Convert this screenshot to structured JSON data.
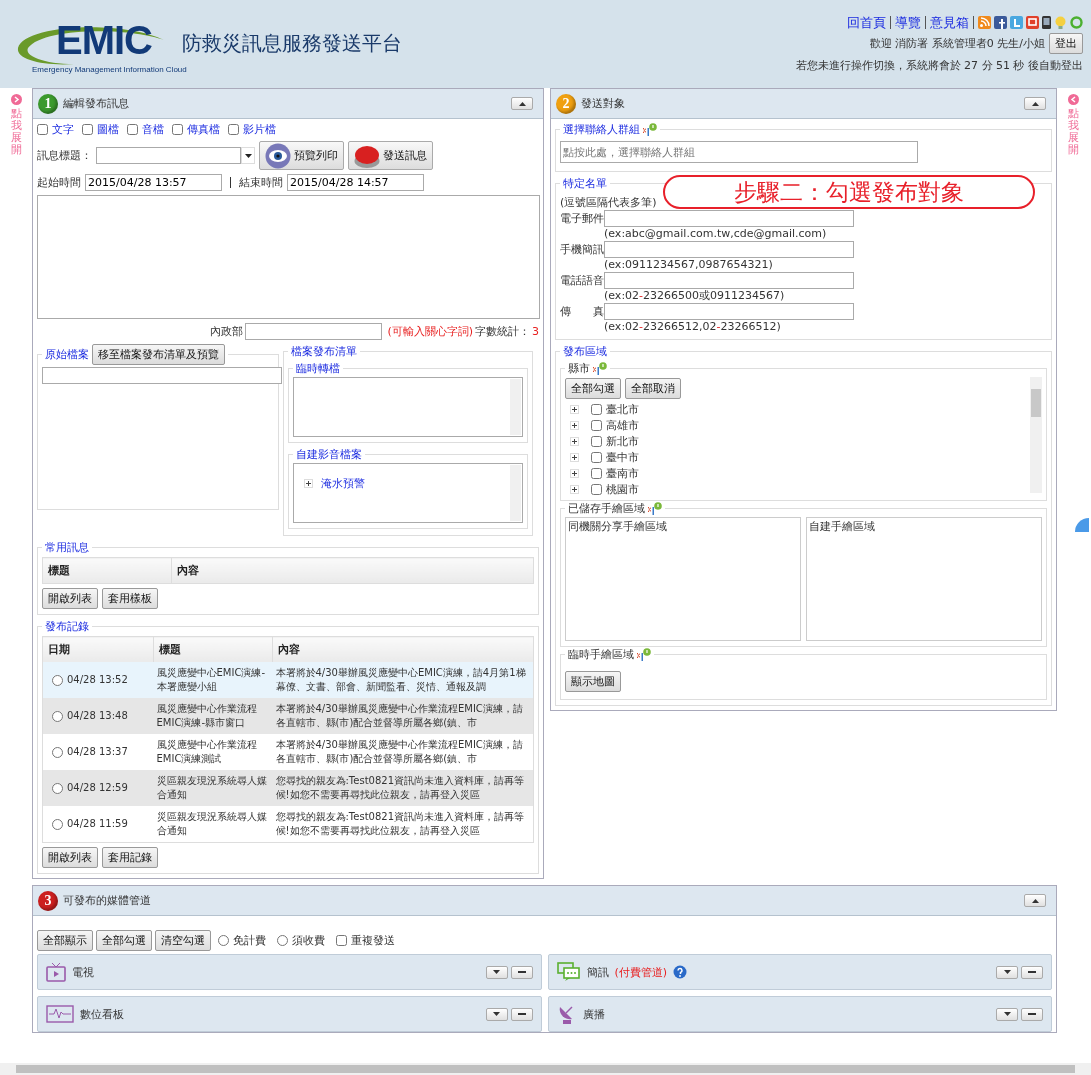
{
  "header": {
    "logo": "EMIC",
    "logo_subtitle": "Emergency Management Information Cloud",
    "title": "防救災訊息服務發送平台",
    "links": [
      "回首頁",
      "導覽",
      "意見箱"
    ],
    "welcome": "歡迎 消防署 系統管理者0 先生/小姐",
    "logout": "登出",
    "timeout": "若您未進行操作切換，系統將會於 27 分 51 秒 後自動登出"
  },
  "side_tabs": [
    "點我展開",
    "點我展開"
  ],
  "edit_panel": {
    "step": "1",
    "title": "編輯發布訊息",
    "file_types": [
      {
        "label": "文字",
        "checked": false
      },
      {
        "label": "圖檔",
        "checked": false
      },
      {
        "label": "音檔",
        "checked": false
      },
      {
        "label": "傳真檔",
        "checked": false
      },
      {
        "label": "影片檔",
        "checked": false
      }
    ],
    "subject_label": "訊息標題：",
    "preview_button": "預覽列印",
    "send_button": "發送訊息",
    "start_label": "起始時間",
    "start_value": "2015/04/28 13:57",
    "end_label": "結束時間",
    "end_value": "2015/04/28 14:57",
    "dept_label": "內政部",
    "keyword_hint": "(可輸入關心字詞)",
    "count_label": "字數統計：",
    "count": "3",
    "original_files": {
      "legend": "原始檔案",
      "move_button": "移至檔案發布清單及預覽"
    },
    "publish_list": {
      "legend": "檔案發布清單",
      "temp_legend": "臨時轉檔",
      "custom_legend": "自建影音檔案",
      "custom_items": [
        {
          "label": "淹水預警",
          "expanded": false
        }
      ]
    },
    "common": {
      "legend": "常用訊息",
      "columns": [
        "標題",
        "內容"
      ],
      "buttons": [
        "開啟列表",
        "套用樣板"
      ]
    },
    "history": {
      "legend": "發布記錄",
      "columns": [
        "日期",
        "標題",
        "內容"
      ],
      "rows": [
        {
          "date": "04/28 13:52",
          "title": "風災應變中心EMIC演練-本署應變小組",
          "content": "本署將於4/30舉辦風災應變中心EMIC演練，請4月第1梯幕僚、文書、部會、新聞監看、災情、通報及調",
          "selected": false,
          "highlighted": true
        },
        {
          "date": "04/28 13:48",
          "title": "風災應變中心作業流程EMIC演練-縣市窗口",
          "content": "本署將於4/30舉辦風災應變中心作業流程EMIC演練，請各直轄市、縣(市)配合並督導所屬各鄉(鎮、市",
          "selected": false,
          "highlighted": false
        },
        {
          "date": "04/28 13:37",
          "title": "風災應變中心作業流程EMIC演練測試",
          "content": "本署將於4/30舉辦風災應變中心作業流程EMIC演練，請各直轄市、縣(市)配合並督導所屬各鄉(鎮、市",
          "selected": false,
          "highlighted": false
        },
        {
          "date": "04/28 12:59",
          "title": "災區親友現況系統尋人媒合通知",
          "content": "您尋找的親友為:Test0821資訊尚未進入資料庫，請再等候!如您不需要再尋找此位親友，請再登入災區",
          "selected": false,
          "highlighted": false
        },
        {
          "date": "04/28 11:59",
          "title": "災區親友現況系統尋人媒合通知",
          "content": "您尋找的親友為:Test0821資訊尚未進入資料庫，請再等候!如您不需要再尋找此位親友，請再登入災區",
          "selected": false,
          "highlighted": false
        }
      ],
      "buttons": [
        "開啟列表",
        "套用記錄"
      ]
    }
  },
  "target_panel": {
    "step": "2",
    "title": "發送對象",
    "contact_group": {
      "legend": "選擇聯絡人群組",
      "placeholder": "點按此處，選擇聯絡人群組"
    },
    "specific_list": {
      "legend": "特定名單",
      "note": "(逗號區隔代表多筆)",
      "fields": [
        {
          "label": "電子郵件",
          "example": "(ex:abc@gmail.com.tw,cde@gmail.com)"
        },
        {
          "label": "手機簡訊",
          "example": "(ex:0911234567,0987654321)"
        },
        {
          "label": "電話語音",
          "example": "(ex:02-23266500或0911234567)"
        },
        {
          "label": "傳　　真",
          "example": "(ex:02-23266512,02-23266512)"
        }
      ]
    },
    "region": {
      "legend": "發布區域",
      "county_legend": "縣市",
      "buttons": [
        "全部勾選",
        "全部取消"
      ],
      "counties": [
        {
          "name": "臺北市",
          "checked": false,
          "expanded": false
        },
        {
          "name": "高雄市",
          "checked": false,
          "expanded": false
        },
        {
          "name": "新北市",
          "checked": false,
          "expanded": false
        },
        {
          "name": "臺中市",
          "checked": false,
          "expanded": false
        },
        {
          "name": "臺南市",
          "checked": false,
          "expanded": false
        },
        {
          "name": "桃園市",
          "checked": false,
          "expanded": false
        }
      ],
      "saved_legend": "已儲存手繪區域",
      "saved_boxes": [
        "同機關分享手繪區域",
        "自建手繪區域"
      ],
      "temp_legend": "臨時手繪區域",
      "map_button": "顯示地圖"
    },
    "annotation": "步驟二：勾選發布對象"
  },
  "media_panel": {
    "step": "3",
    "title": "可發布的媒體管道",
    "buttons": [
      "全部顯示",
      "全部勾選",
      "清空勾選"
    ],
    "options": [
      {
        "kind": "radio",
        "label": "免計費",
        "selected": false
      },
      {
        "kind": "radio",
        "label": "須收費",
        "selected": false
      },
      {
        "kind": "checkbox",
        "label": "重複發送",
        "checked": false
      }
    ],
    "channels": [
      {
        "kind": "tv",
        "name": "電視"
      },
      {
        "kind": "chat",
        "name": "簡訊",
        "note": "(付費管道)"
      },
      {
        "kind": "board",
        "name": "數位看板"
      },
      {
        "kind": "dish",
        "name": "廣播"
      }
    ]
  }
}
